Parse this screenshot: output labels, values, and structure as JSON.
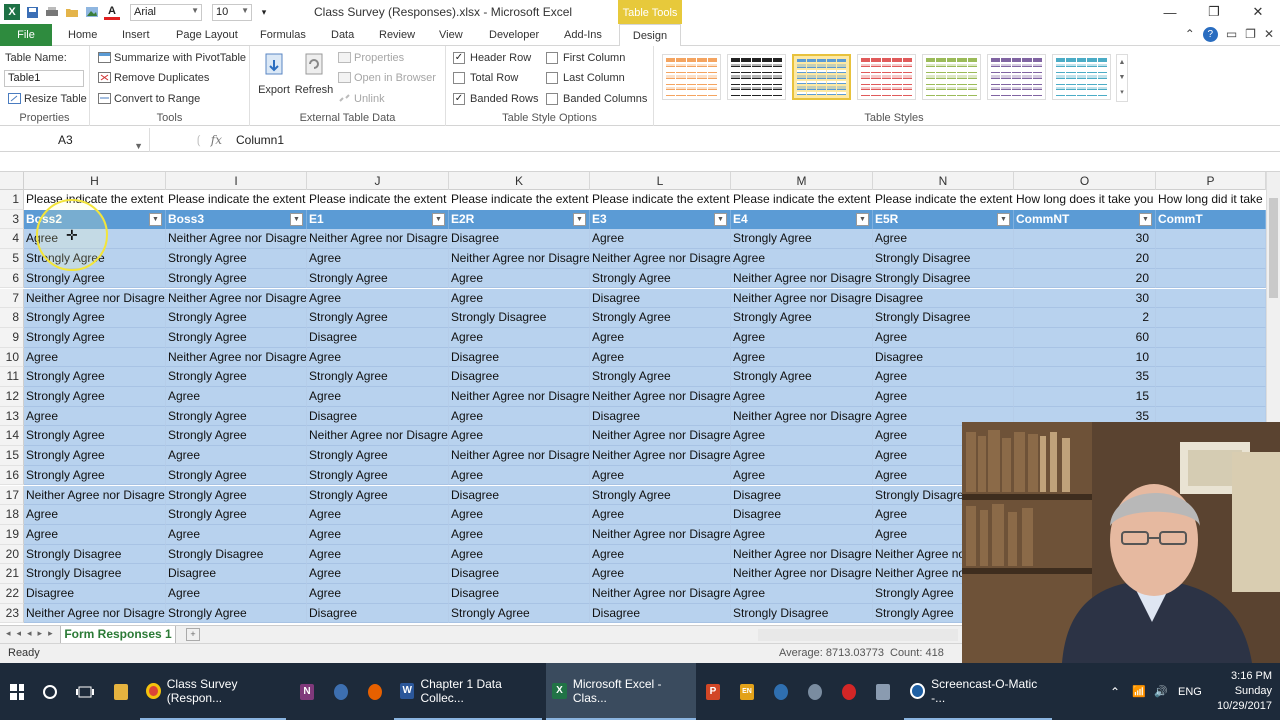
{
  "window": {
    "title": "Class Survey (Responses).xlsx - Microsoft Excel",
    "font_name": "Arial",
    "font_size": "10",
    "contextual_tab": "Table Tools",
    "buttons": [
      "minimize",
      "restore",
      "close"
    ]
  },
  "tabs": [
    "File",
    "Home",
    "Insert",
    "Page Layout",
    "Formulas",
    "Data",
    "Review",
    "View",
    "Developer",
    "Add-Ins",
    "Design"
  ],
  "active_tab": "Design",
  "ribbon": {
    "properties": {
      "label": "Properties",
      "table_name_label": "Table Name:",
      "table_name_value": "Table1",
      "resize": "Resize Table"
    },
    "tools": {
      "label": "Tools",
      "summarize": "Summarize with PivotTable",
      "remove_duplicates": "Remove Duplicates",
      "convert": "Convert to Range"
    },
    "external": {
      "label": "External Table Data",
      "export": "Export",
      "refresh": "Refresh",
      "properties": "Properties",
      "open_browser": "Open in Browser",
      "unlink": "Unlink"
    },
    "options": {
      "label": "Table Style Options",
      "header_row": {
        "label": "Header Row",
        "checked": true
      },
      "total_row": {
        "label": "Total Row",
        "checked": false
      },
      "banded_rows": {
        "label": "Banded Rows",
        "checked": true
      },
      "first_column": {
        "label": "First Column",
        "checked": false
      },
      "last_column": {
        "label": "Last Column",
        "checked": false
      },
      "banded_columns": {
        "label": "Banded Columns",
        "checked": false
      }
    },
    "styles": {
      "label": "Table Styles",
      "swatches": [
        "#f4a460",
        "#222222",
        "#5b9bd5",
        "#e05a5a",
        "#9bbb59",
        "#8064a2",
        "#4bacc6"
      ],
      "selected_index": 2
    }
  },
  "formula_bar": {
    "cell_ref": "A3",
    "content": "Column1",
    "fx": "fx"
  },
  "grid": {
    "columns": [
      "H",
      "I",
      "J",
      "K",
      "L",
      "M",
      "N",
      "O",
      "P"
    ],
    "row1_number": "1",
    "row1": [
      "Please indicate the extent",
      "Please indicate the extent",
      "Please indicate the extent",
      "Please indicate the extent",
      "Please indicate the extent",
      "Please indicate the extent",
      "Please indicate the extent",
      "How long does it take you",
      "How long did it take"
    ],
    "header_row_number": "3",
    "headers": [
      "Boss2",
      "Boss3",
      "E1",
      "E2R",
      "E3",
      "E4",
      "E5R",
      "CommNT",
      "CommT"
    ],
    "rows": [
      {
        "n": "4",
        "c": [
          "Agree",
          "Neither Agree nor Disagree",
          "Neither Agree nor Disagree",
          "Disagree",
          "Agree",
          "Strongly Agree",
          "Agree",
          "30",
          ""
        ]
      },
      {
        "n": "5",
        "c": [
          "Strongly Agree",
          "Strongly Agree",
          "Agree",
          "Neither Agree nor Disagree",
          "Neither Agree nor Disagree",
          "Agree",
          "Strongly Disagree",
          "20",
          ""
        ]
      },
      {
        "n": "6",
        "c": [
          "Strongly Agree",
          "Strongly Agree",
          "Strongly Agree",
          "Agree",
          "Strongly Agree",
          "Neither Agree nor Disagree",
          "Strongly Disagree",
          "20",
          ""
        ]
      },
      {
        "n": "7",
        "c": [
          "Neither Agree nor Disagree",
          "Neither Agree nor Disagree",
          "Agree",
          "Agree",
          "Disagree",
          "Neither Agree nor Disagree",
          "Disagree",
          "30",
          ""
        ]
      },
      {
        "n": "8",
        "c": [
          "Strongly Agree",
          "Strongly Agree",
          "Strongly Agree",
          "Strongly Disagree",
          "Strongly Agree",
          "Strongly Agree",
          "Strongly Disagree",
          "2",
          ""
        ]
      },
      {
        "n": "9",
        "c": [
          "Strongly Agree",
          "Strongly Agree",
          "Disagree",
          "Agree",
          "Agree",
          "Agree",
          "Agree",
          "60",
          ""
        ]
      },
      {
        "n": "10",
        "c": [
          "Agree",
          "Neither Agree nor Disagree",
          "Agree",
          "Disagree",
          "Agree",
          "Agree",
          "Disagree",
          "10",
          ""
        ]
      },
      {
        "n": "11",
        "c": [
          "Strongly Agree",
          "Strongly Agree",
          "Strongly Agree",
          "Disagree",
          "Strongly Agree",
          "Strongly Agree",
          "Agree",
          "35",
          ""
        ]
      },
      {
        "n": "12",
        "c": [
          "Strongly Agree",
          "Agree",
          "Agree",
          "Neither Agree nor Disagree",
          "Neither Agree nor Disagree",
          "Agree",
          "Agree",
          "15",
          ""
        ]
      },
      {
        "n": "13",
        "c": [
          "Agree",
          "Strongly Agree",
          "Disagree",
          "Agree",
          "Disagree",
          "Neither Agree nor Disagree",
          "Agree",
          "35",
          ""
        ]
      },
      {
        "n": "14",
        "c": [
          "Strongly Agree",
          "Strongly Agree",
          "Neither Agree nor Disagree",
          "Agree",
          "Neither Agree nor Disagree",
          "Agree",
          "Agree",
          "",
          ""
        ]
      },
      {
        "n": "15",
        "c": [
          "Strongly Agree",
          "Agree",
          "Strongly Agree",
          "Neither Agree nor Disagree",
          "Neither Agree nor Disagree",
          "Agree",
          "Agree",
          "",
          ""
        ]
      },
      {
        "n": "16",
        "c": [
          "Strongly Agree",
          "Strongly Agree",
          "Strongly Agree",
          "Agree",
          "Agree",
          "Agree",
          "Agree",
          "",
          ""
        ]
      },
      {
        "n": "17",
        "c": [
          "Neither Agree nor Disagree",
          "Strongly Agree",
          "Strongly Agree",
          "Disagree",
          "Strongly Agree",
          "Disagree",
          "Strongly Disagree",
          "",
          ""
        ]
      },
      {
        "n": "18",
        "c": [
          "Agree",
          "Strongly Agree",
          "Agree",
          "Agree",
          "Agree",
          "Disagree",
          "Agree",
          "",
          ""
        ]
      },
      {
        "n": "19",
        "c": [
          "Agree",
          "Agree",
          "Agree",
          "Agree",
          "Neither Agree nor Disagree",
          "Agree",
          "Agree",
          "",
          ""
        ]
      },
      {
        "n": "20",
        "c": [
          "Strongly Disagree",
          "Strongly Disagree",
          "Agree",
          "Agree",
          "Agree",
          "Neither Agree nor Disagree",
          "Neither Agree nor Disagree",
          "",
          ""
        ]
      },
      {
        "n": "21",
        "c": [
          "Strongly Disagree",
          "Disagree",
          "Agree",
          "Disagree",
          "Agree",
          "Neither Agree nor Disagree",
          "Neither Agree nor Disagree",
          "",
          ""
        ]
      },
      {
        "n": "22",
        "c": [
          "Disagree",
          "Agree",
          "Agree",
          "Disagree",
          "Neither Agree nor Disagree",
          "Agree",
          "Strongly Agree",
          "",
          ""
        ]
      },
      {
        "n": "23",
        "c": [
          "Neither Agree nor Disagree",
          "Strongly Agree",
          "Disagree",
          "Strongly Agree",
          "Disagree",
          "Strongly Disagree",
          "Strongly Agree",
          "",
          ""
        ]
      }
    ]
  },
  "sheet_tab": "Form Responses 1",
  "status": {
    "ready": "Ready",
    "average": "Average: 8713.03773",
    "count": "Count: 418"
  },
  "taskbar": {
    "items": [
      {
        "label": "Class Survey (Respon...",
        "icon": "chrome-icon"
      },
      {
        "label": "Chapter 1 Data Collec...",
        "icon": "word-icon"
      },
      {
        "label": "Microsoft Excel - Clas...",
        "icon": "excel-icon"
      },
      {
        "label": "Screencast-O-Matic -...",
        "icon": "screencast-icon"
      }
    ],
    "lang": "ENG",
    "time": "3:16 PM",
    "day": "Sunday",
    "date": "10/29/2017"
  }
}
